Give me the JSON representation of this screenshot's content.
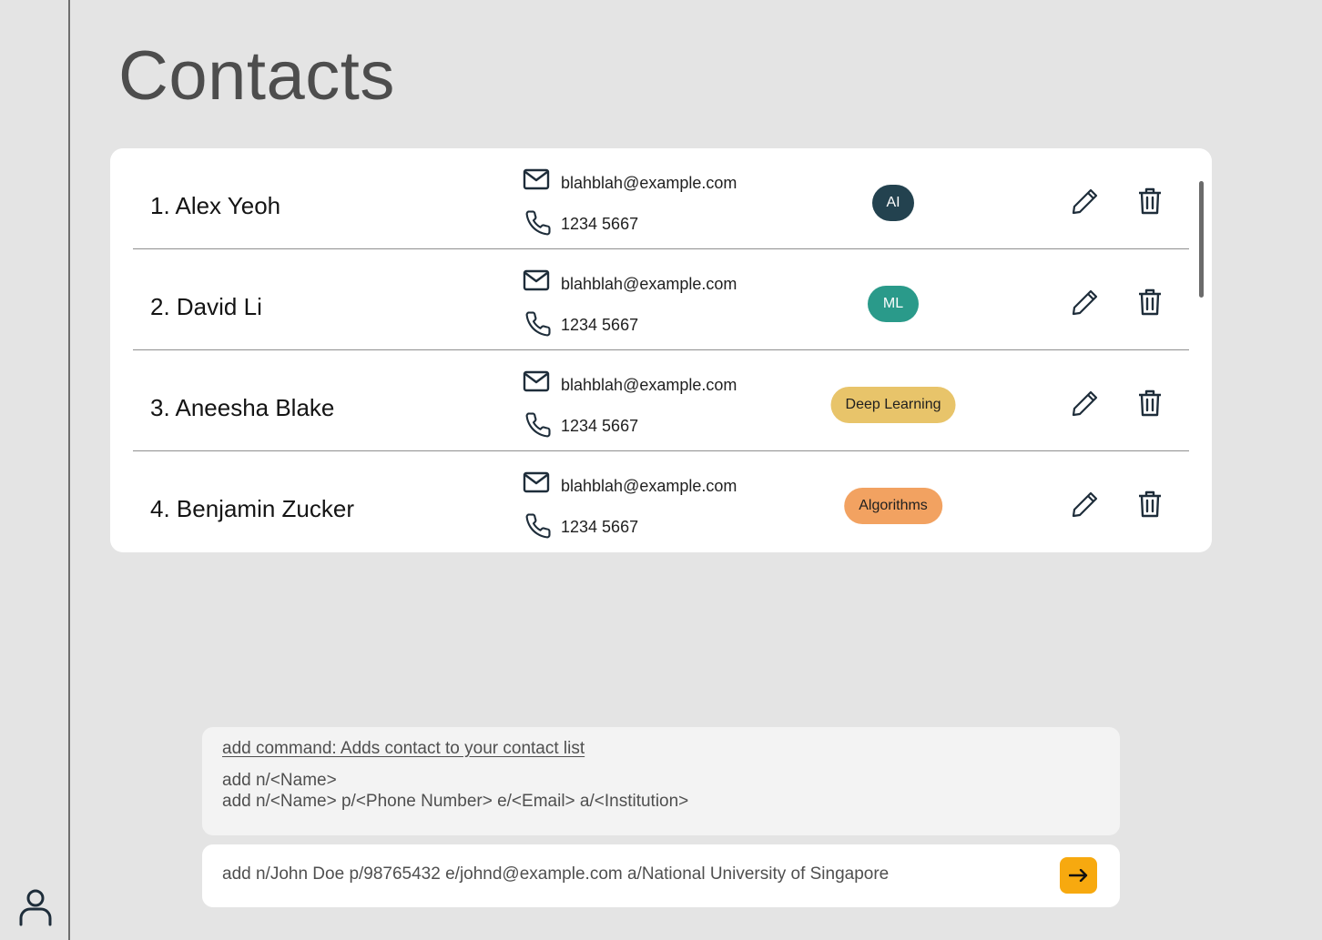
{
  "page": {
    "title": "Contacts"
  },
  "contacts": [
    {
      "index_name": "1. Alex Yeoh",
      "email": "blahblah@example.com",
      "phone": "1234 5667",
      "tag": {
        "label": "AI",
        "bg": "#23424f",
        "fg": "#ffffff"
      }
    },
    {
      "index_name": "2. David Li",
      "email": "blahblah@example.com",
      "phone": "1234 5667",
      "tag": {
        "label": "ML",
        "bg": "#2a9a8a",
        "fg": "#ffffff"
      }
    },
    {
      "index_name": "3. Aneesha Blake",
      "email": "blahblah@example.com",
      "phone": "1234 5667",
      "tag": {
        "label": "Deep Learning",
        "bg": "#e8c46a",
        "fg": "#1f1f1f"
      }
    },
    {
      "index_name": "4. Benjamin Zucker",
      "email": "blahblah@example.com",
      "phone": "1234 5667",
      "tag": {
        "label": "Algorithms",
        "bg": "#f2a261",
        "fg": "#1f1f1f"
      }
    }
  ],
  "help": {
    "title": "add command: Adds contact to your contact list",
    "lines": [
      "add n/<Name>",
      "add n/<Name> p/<Phone Number> e/<Email> a/<Institution>"
    ]
  },
  "command": {
    "value": "add n/John Doe p/98765432 e/johnd@example.com a/National University of Singapore"
  },
  "icons": {
    "profile": "user-icon",
    "email": "envelope-icon",
    "phone": "phone-icon",
    "edit": "pencil-icon",
    "delete": "trash-icon",
    "send": "arrow-right-icon"
  },
  "colors": {
    "background": "#e4e4e4",
    "accent": "#f7a90f",
    "icon": "#1e2d3a"
  }
}
